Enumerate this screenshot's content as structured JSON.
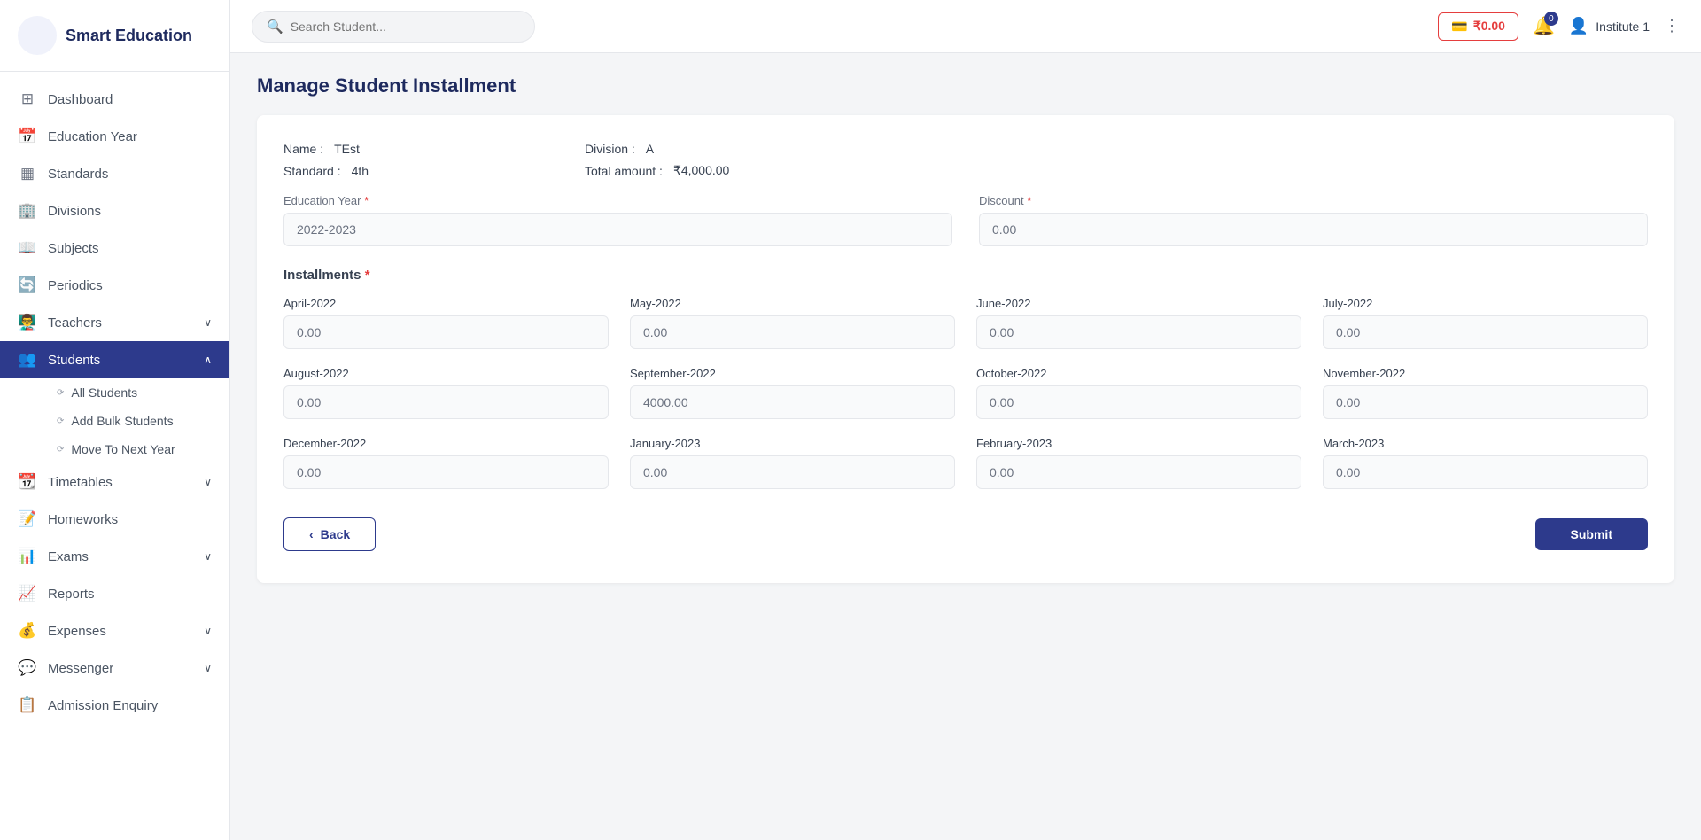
{
  "app": {
    "name": "Smart Education"
  },
  "sidebar": {
    "nav_items": [
      {
        "id": "dashboard",
        "label": "Dashboard",
        "icon": "⊞",
        "active": false,
        "has_arrow": false
      },
      {
        "id": "education-year",
        "label": "Education Year",
        "icon": "📅",
        "active": false,
        "has_arrow": false
      },
      {
        "id": "standards",
        "label": "Standards",
        "icon": "📋",
        "active": false,
        "has_arrow": false
      },
      {
        "id": "divisions",
        "label": "Divisions",
        "icon": "🏢",
        "active": false,
        "has_arrow": false
      },
      {
        "id": "subjects",
        "label": "Subjects",
        "icon": "📖",
        "active": false,
        "has_arrow": false
      },
      {
        "id": "periodics",
        "label": "Periodics",
        "icon": "🔄",
        "active": false,
        "has_arrow": false
      },
      {
        "id": "teachers",
        "label": "Teachers",
        "icon": "👨‍🏫",
        "active": false,
        "has_arrow": true
      },
      {
        "id": "students",
        "label": "Students",
        "icon": "👥",
        "active": true,
        "has_arrow": true
      }
    ],
    "students_subnav": [
      {
        "id": "all-students",
        "label": "All Students"
      },
      {
        "id": "add-bulk-students",
        "label": "Add Bulk Students"
      },
      {
        "id": "move-to-next-year",
        "label": "Move To Next Year"
      }
    ],
    "nav_items_bottom": [
      {
        "id": "timetables",
        "label": "Timetables",
        "icon": "📆",
        "has_arrow": true
      },
      {
        "id": "homeworks",
        "label": "Homeworks",
        "icon": "📝",
        "has_arrow": false
      },
      {
        "id": "exams",
        "label": "Exams",
        "icon": "📊",
        "has_arrow": true
      },
      {
        "id": "reports",
        "label": "Reports",
        "icon": "📈",
        "has_arrow": false
      },
      {
        "id": "expenses",
        "label": "Expenses",
        "icon": "💰",
        "has_arrow": true
      },
      {
        "id": "messenger",
        "label": "Messenger",
        "icon": "💬",
        "has_arrow": true
      },
      {
        "id": "admission-enquiry",
        "label": "Admission Enquiry",
        "icon": "📋",
        "has_arrow": false
      }
    ]
  },
  "header": {
    "search_placeholder": "Search Student...",
    "wallet_amount": "₹0.00",
    "notification_count": "0",
    "user_name": "Institute 1"
  },
  "page": {
    "title": "Manage Student Installment"
  },
  "student_info": {
    "name_label": "Name :",
    "name_value": "TEst",
    "standard_label": "Standard :",
    "standard_value": "4th",
    "division_label": "Division :",
    "division_value": "A",
    "total_amount_label": "Total amount :",
    "total_amount_value": "₹4,000.00"
  },
  "form": {
    "education_year_label": "Education Year",
    "education_year_value": "2022-2023",
    "discount_label": "Discount",
    "discount_value": "0.00",
    "installments_label": "Installments"
  },
  "installments": [
    {
      "month": "April-2022",
      "value": "0.00"
    },
    {
      "month": "May-2022",
      "value": "0.00"
    },
    {
      "month": "June-2022",
      "value": "0.00"
    },
    {
      "month": "July-2022",
      "value": "0.00"
    },
    {
      "month": "August-2022",
      "value": "0.00"
    },
    {
      "month": "September-2022",
      "value": "4000.00"
    },
    {
      "month": "October-2022",
      "value": "0.00"
    },
    {
      "month": "November-2022",
      "value": "0.00"
    },
    {
      "month": "December-2022",
      "value": "0.00"
    },
    {
      "month": "January-2023",
      "value": "0.00"
    },
    {
      "month": "February-2023",
      "value": "0.00"
    },
    {
      "month": "March-2023",
      "value": "0.00"
    }
  ],
  "buttons": {
    "back_label": "Back",
    "submit_label": "Submit"
  }
}
